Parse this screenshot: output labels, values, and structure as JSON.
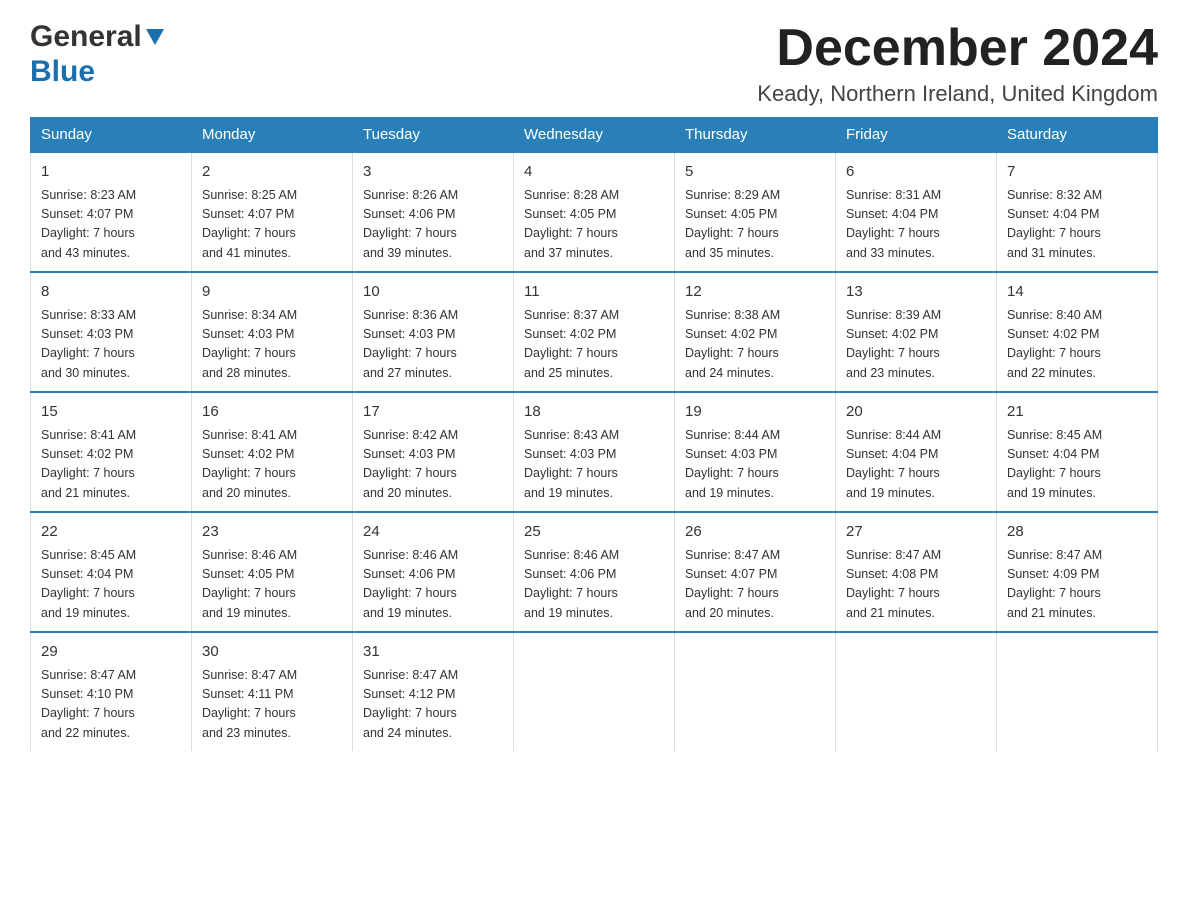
{
  "header": {
    "logo_line1": "General",
    "logo_line2": "Blue",
    "month_title": "December 2024",
    "location": "Keady, Northern Ireland, United Kingdom"
  },
  "weekdays": [
    "Sunday",
    "Monday",
    "Tuesday",
    "Wednesday",
    "Thursday",
    "Friday",
    "Saturday"
  ],
  "weeks": [
    [
      {
        "day": "1",
        "sunrise": "8:23 AM",
        "sunset": "4:07 PM",
        "daylight": "7 hours and 43 minutes."
      },
      {
        "day": "2",
        "sunrise": "8:25 AM",
        "sunset": "4:07 PM",
        "daylight": "7 hours and 41 minutes."
      },
      {
        "day": "3",
        "sunrise": "8:26 AM",
        "sunset": "4:06 PM",
        "daylight": "7 hours and 39 minutes."
      },
      {
        "day": "4",
        "sunrise": "8:28 AM",
        "sunset": "4:05 PM",
        "daylight": "7 hours and 37 minutes."
      },
      {
        "day": "5",
        "sunrise": "8:29 AM",
        "sunset": "4:05 PM",
        "daylight": "7 hours and 35 minutes."
      },
      {
        "day": "6",
        "sunrise": "8:31 AM",
        "sunset": "4:04 PM",
        "daylight": "7 hours and 33 minutes."
      },
      {
        "day": "7",
        "sunrise": "8:32 AM",
        "sunset": "4:04 PM",
        "daylight": "7 hours and 31 minutes."
      }
    ],
    [
      {
        "day": "8",
        "sunrise": "8:33 AM",
        "sunset": "4:03 PM",
        "daylight": "7 hours and 30 minutes."
      },
      {
        "day": "9",
        "sunrise": "8:34 AM",
        "sunset": "4:03 PM",
        "daylight": "7 hours and 28 minutes."
      },
      {
        "day": "10",
        "sunrise": "8:36 AM",
        "sunset": "4:03 PM",
        "daylight": "7 hours and 27 minutes."
      },
      {
        "day": "11",
        "sunrise": "8:37 AM",
        "sunset": "4:02 PM",
        "daylight": "7 hours and 25 minutes."
      },
      {
        "day": "12",
        "sunrise": "8:38 AM",
        "sunset": "4:02 PM",
        "daylight": "7 hours and 24 minutes."
      },
      {
        "day": "13",
        "sunrise": "8:39 AM",
        "sunset": "4:02 PM",
        "daylight": "7 hours and 23 minutes."
      },
      {
        "day": "14",
        "sunrise": "8:40 AM",
        "sunset": "4:02 PM",
        "daylight": "7 hours and 22 minutes."
      }
    ],
    [
      {
        "day": "15",
        "sunrise": "8:41 AM",
        "sunset": "4:02 PM",
        "daylight": "7 hours and 21 minutes."
      },
      {
        "day": "16",
        "sunrise": "8:41 AM",
        "sunset": "4:02 PM",
        "daylight": "7 hours and 20 minutes."
      },
      {
        "day": "17",
        "sunrise": "8:42 AM",
        "sunset": "4:03 PM",
        "daylight": "7 hours and 20 minutes."
      },
      {
        "day": "18",
        "sunrise": "8:43 AM",
        "sunset": "4:03 PM",
        "daylight": "7 hours and 19 minutes."
      },
      {
        "day": "19",
        "sunrise": "8:44 AM",
        "sunset": "4:03 PM",
        "daylight": "7 hours and 19 minutes."
      },
      {
        "day": "20",
        "sunrise": "8:44 AM",
        "sunset": "4:04 PM",
        "daylight": "7 hours and 19 minutes."
      },
      {
        "day": "21",
        "sunrise": "8:45 AM",
        "sunset": "4:04 PM",
        "daylight": "7 hours and 19 minutes."
      }
    ],
    [
      {
        "day": "22",
        "sunrise": "8:45 AM",
        "sunset": "4:04 PM",
        "daylight": "7 hours and 19 minutes."
      },
      {
        "day": "23",
        "sunrise": "8:46 AM",
        "sunset": "4:05 PM",
        "daylight": "7 hours and 19 minutes."
      },
      {
        "day": "24",
        "sunrise": "8:46 AM",
        "sunset": "4:06 PM",
        "daylight": "7 hours and 19 minutes."
      },
      {
        "day": "25",
        "sunrise": "8:46 AM",
        "sunset": "4:06 PM",
        "daylight": "7 hours and 19 minutes."
      },
      {
        "day": "26",
        "sunrise": "8:47 AM",
        "sunset": "4:07 PM",
        "daylight": "7 hours and 20 minutes."
      },
      {
        "day": "27",
        "sunrise": "8:47 AM",
        "sunset": "4:08 PM",
        "daylight": "7 hours and 21 minutes."
      },
      {
        "day": "28",
        "sunrise": "8:47 AM",
        "sunset": "4:09 PM",
        "daylight": "7 hours and 21 minutes."
      }
    ],
    [
      {
        "day": "29",
        "sunrise": "8:47 AM",
        "sunset": "4:10 PM",
        "daylight": "7 hours and 22 minutes."
      },
      {
        "day": "30",
        "sunrise": "8:47 AM",
        "sunset": "4:11 PM",
        "daylight": "7 hours and 23 minutes."
      },
      {
        "day": "31",
        "sunrise": "8:47 AM",
        "sunset": "4:12 PM",
        "daylight": "7 hours and 24 minutes."
      },
      null,
      null,
      null,
      null
    ]
  ],
  "labels": {
    "sunrise": "Sunrise:",
    "sunset": "Sunset:",
    "daylight": "Daylight:"
  }
}
